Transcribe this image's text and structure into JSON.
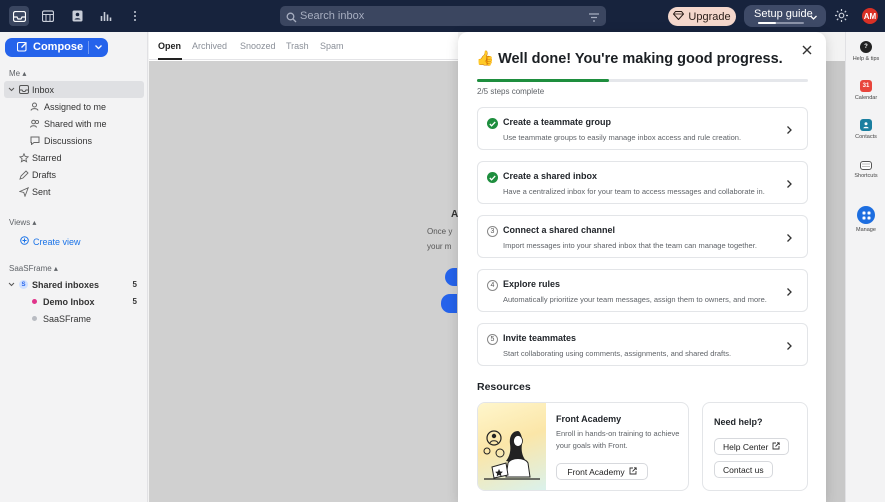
{
  "topbar": {
    "search_placeholder": "Search inbox",
    "upgrade_label": "Upgrade",
    "setup_guide_label": "Setup guide",
    "setup_progress": 0.4,
    "avatar_initials": "AM"
  },
  "sidebar": {
    "compose_label": "Compose",
    "me_section": "Me",
    "items": [
      {
        "label": "Inbox"
      },
      {
        "label": "Assigned to me"
      },
      {
        "label": "Shared with me"
      },
      {
        "label": "Discussions"
      },
      {
        "label": "Starred"
      },
      {
        "label": "Drafts"
      },
      {
        "label": "Sent"
      }
    ],
    "views_section": "Views",
    "create_view_label": "Create view",
    "workspace_section": "SaaSFrame",
    "shared_inboxes": {
      "label": "Shared inboxes",
      "count": "5",
      "badge": "S"
    },
    "demo_inbox": {
      "label": "Demo Inbox",
      "count": "5"
    },
    "saasframe_item": {
      "label": "SaaSFrame"
    }
  },
  "center": {
    "tabs": [
      "Open",
      "Archived",
      "Snoozed",
      "Trash",
      "Spam"
    ],
    "empty_title": "A",
    "empty_line1": "Once y",
    "empty_line2": "your m"
  },
  "rail": {
    "items": [
      {
        "label": "Help & tips",
        "icon": "question-icon"
      },
      {
        "label": "Calendar",
        "icon": "calendar-icon",
        "badge": "31"
      },
      {
        "label": "Contacts",
        "icon": "contacts-icon"
      },
      {
        "label": "Shortcuts",
        "icon": "keyboard-icon"
      },
      {
        "label": "Manage",
        "icon": "apps-icon"
      }
    ]
  },
  "modal": {
    "emoji": "👍",
    "title": "Well done! You're making good progress.",
    "progress": 0.4,
    "progress_text": "2/5 steps complete",
    "steps": [
      {
        "title": "Create a teammate group",
        "desc": "Use teammate groups to easily manage inbox access and rule creation.",
        "done": true,
        "num": "1"
      },
      {
        "title": "Create a shared inbox",
        "desc": "Have a centralized inbox for your team to access messages and collaborate in.",
        "done": true,
        "num": "2"
      },
      {
        "title": "Connect a shared channel",
        "desc": "Import messages into your shared inbox that the team can manage together.",
        "done": false,
        "num": "3"
      },
      {
        "title": "Explore rules",
        "desc": "Automatically prioritize your team messages, assign them to owners, and more.",
        "done": false,
        "num": "4"
      },
      {
        "title": "Invite teammates",
        "desc": "Start collaborating using comments, assignments, and shared drafts.",
        "done": false,
        "num": "5"
      }
    ],
    "resources_heading": "Resources",
    "academy": {
      "title": "Front Academy",
      "desc": "Enroll in hands-on training to achieve your goals with Front.",
      "button": "Front Academy"
    },
    "help": {
      "title": "Need help?",
      "help_center": "Help Center",
      "contact_us": "Contact us"
    }
  },
  "colors": {
    "topbar": "#17233d",
    "accent": "#2563eb",
    "success": "#1e8e3e",
    "upgrade_bg": "#f4d7cc"
  }
}
